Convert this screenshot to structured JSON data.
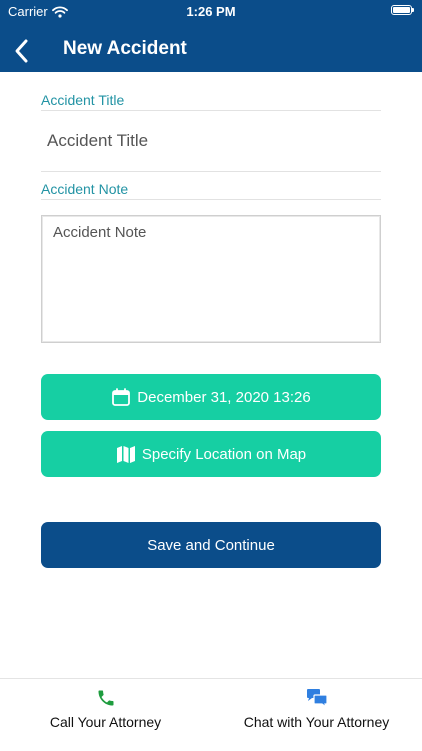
{
  "status_bar": {
    "carrier": "Carrier",
    "time": "1:26 PM"
  },
  "header": {
    "title": "New Accident"
  },
  "form": {
    "accident_title_label": "Accident Title",
    "accident_title_placeholder": "Accident Title",
    "accident_note_label": "Accident Note",
    "accident_note_placeholder": "Accident Note"
  },
  "buttons": {
    "date": "December 31, 2020 13:26",
    "location": "Specify Location on Map",
    "save": "Save and Continue"
  },
  "tabbar": {
    "call": "Call Your Attorney",
    "chat": "Chat with Your Attorney"
  },
  "colors": {
    "header": "#0b4d8a",
    "accent_teal": "#16cfa3",
    "label_teal": "#2293a4",
    "call_icon": "#1e9c3e",
    "chat_icon": "#2f7fe0"
  },
  "icons": {
    "back": "chevron-left-icon",
    "date": "calendar-icon",
    "location": "map-icon",
    "call": "phone-icon",
    "chat": "chat-bubbles-icon",
    "wifi": "wifi-icon",
    "battery": "battery-icon"
  }
}
